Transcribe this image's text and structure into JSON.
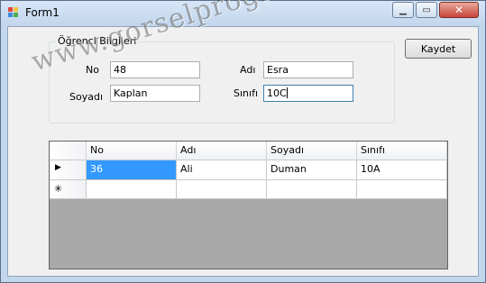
{
  "window": {
    "title": "Form1"
  },
  "form": {
    "group_title": "Öğrenci Bilgileri",
    "labels": {
      "no": "No",
      "soyadi": "Soyadı",
      "adi": "Adı",
      "sinifi": "Sınıfı"
    },
    "values": {
      "no": "48",
      "soyadi": "Kaplan",
      "adi": "Esra",
      "sinifi": "10C"
    },
    "save_button": "Kaydet"
  },
  "grid": {
    "columns": [
      "No",
      "Adı",
      "Soyadı",
      "Sınıfı"
    ],
    "rows": [
      [
        "36",
        "Ali",
        "Duman",
        "10A"
      ]
    ],
    "current_row_glyph": "▶",
    "new_row_glyph": "✳"
  },
  "watermark": "www.gorselprogramlama.com",
  "colors": {
    "selection": "#3399ff",
    "close_button": "#c8453a",
    "grid_background": "#a9a9a9"
  }
}
